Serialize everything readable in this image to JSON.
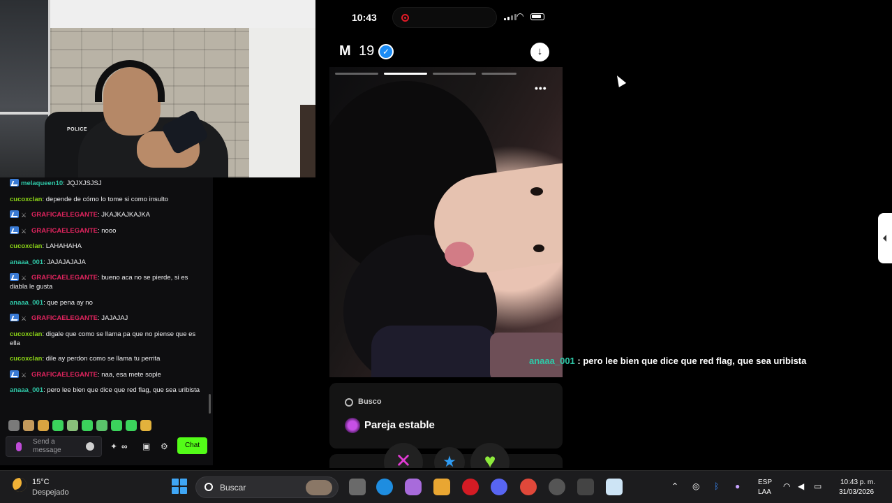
{
  "webcam": {
    "chair_label": "POLICE"
  },
  "chat": {
    "messages": [
      {
        "user": "melaqueen10",
        "text": ": JQJXJSJSJ",
        "color": "#2fc7a7",
        "badges": "sub"
      },
      {
        "user": "cucoxclan",
        "text": ": depende de cómo lo tome si como insulto",
        "color": "#8bd317",
        "badges": ""
      },
      {
        "user": "GRAFICAELEGANTE",
        "text": ": JKAJKAJKAJKA",
        "color": "#e0245e",
        "badges": "sub-sword"
      },
      {
        "user": "GRAFICAELEGANTE",
        "text": ": nooo",
        "color": "#e0245e",
        "badges": "sub-sword"
      },
      {
        "user": "cucoxclan",
        "text": ": LAHAHAHA",
        "color": "#8bd317",
        "badges": ""
      },
      {
        "user": "anaaa_001",
        "text": ": JAJAJAJAJA",
        "color": "#2fc7a7",
        "badges": ""
      },
      {
        "user": "GRAFICAELEGANTE",
        "text": ": bueno aca no se pierde, si es diabla le gusta",
        "color": "#e0245e",
        "badges": "sub-sword"
      },
      {
        "user": "anaaa_001",
        "text": ": que pena ay no",
        "color": "#2fc7a7",
        "badges": ""
      },
      {
        "user": "GRAFICAELEGANTE",
        "text": ": JAJAJAJ",
        "color": "#e0245e",
        "badges": "sub-sword"
      },
      {
        "user": "cucoxclan",
        "text": ": digale que como se llama pa que no piense que es ella",
        "color": "#8bd317",
        "badges": ""
      },
      {
        "user": "cucoxclan",
        "text": ": dile ay perdon como se llama tu perrita",
        "color": "#8bd317",
        "badges": ""
      },
      {
        "user": "GRAFICAELEGANTE",
        "text": ": naa, esa mete sople",
        "color": "#e0245e",
        "badges": "sub-sword"
      },
      {
        "user": "anaaa_001",
        "text": ": pero lee bien que dice que red flag, que sea uribista",
        "color": "#2fc7a7",
        "badges": ""
      }
    ],
    "input_placeholder": "Send a message",
    "chat_button": "Chat",
    "infinity_glyph": "∞"
  },
  "phone": {
    "time": "10:43",
    "profile_initial": "M",
    "profile_age": "19",
    "looking_for_label": "Busco",
    "looking_for_value": "Pareja estable",
    "more_glyph": "•••"
  },
  "overlay": {
    "user": "anaaa_001",
    "text": " : pero lee bien que dice que red flag, que sea uribista"
  },
  "taskbar": {
    "temperature": "15°C",
    "weather": "Despejado",
    "search_label": "Buscar",
    "language_top": "ESP",
    "language_bottom": "LAA",
    "clock_time": "10:43 p. m.",
    "clock_date": "31/03/2026"
  }
}
